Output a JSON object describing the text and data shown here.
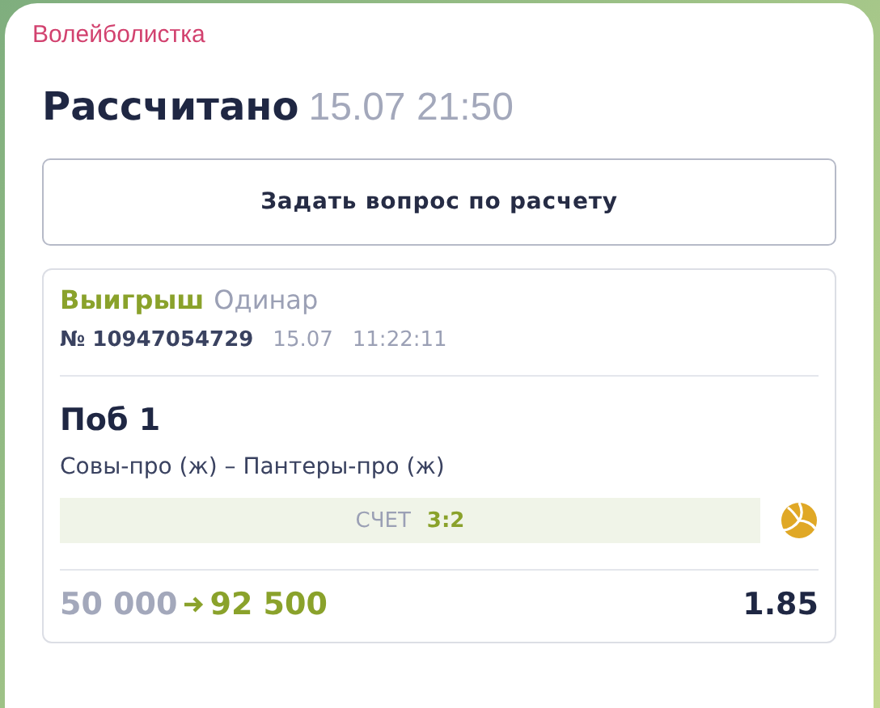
{
  "message": {
    "sender": "Волейболистка",
    "status": "Рассчитано",
    "settled_at": "15.07 21:50",
    "button": "Задать вопрос по расчету",
    "bet": {
      "result": "Выигрыш",
      "type": "Одинар",
      "number": "№ 10947054729",
      "date": "15.07",
      "time": "11:22:11",
      "outcome": "Поб 1",
      "event": "Совы-про (ж) – Пантеры-про (ж)",
      "score_label": "СЧЕТ",
      "score": "3:2",
      "stake": "50 000",
      "payout": "92 500",
      "odds": "1.85"
    }
  }
}
